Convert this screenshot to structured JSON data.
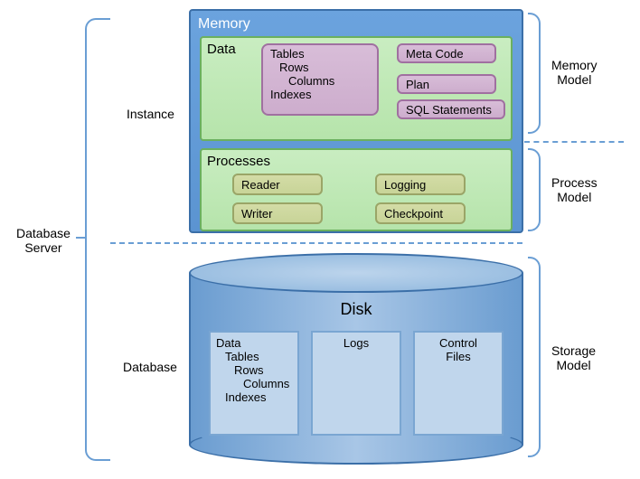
{
  "root_label": "Database\nServer",
  "instance": {
    "label": "Instance",
    "memory": {
      "title": "Memory",
      "data": {
        "title": "Data",
        "tables_box": {
          "l1": "Tables",
          "l2": "Rows",
          "l3": "Columns",
          "l4": "Indexes"
        },
        "meta_code": "Meta Code",
        "plan": "Plan",
        "sql": "SQL Statements"
      },
      "model_label": "Memory\nModel"
    },
    "processes": {
      "title": "Processes",
      "reader": "Reader",
      "writer": "Writer",
      "logging": "Logging",
      "checkpoint": "Checkpoint",
      "model_label": "Process\nModel"
    }
  },
  "database": {
    "label": "Database",
    "disk_title": "Disk",
    "panels": {
      "data": {
        "l1": "Data",
        "l2": "Tables",
        "l3": "Rows",
        "l4": "Columns",
        "l5": "Indexes"
      },
      "logs": "Logs",
      "control": "Control\nFiles"
    },
    "model_label": "Storage\nModel"
  }
}
